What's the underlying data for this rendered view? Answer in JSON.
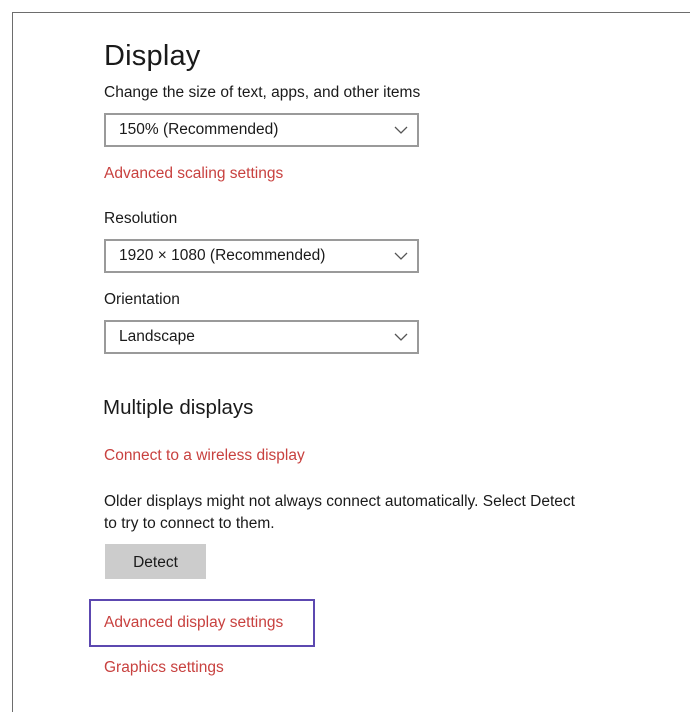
{
  "display": {
    "title": "Display",
    "scale_label": "Change the size of text, apps, and other items",
    "scale_value": "150% (Recommended)",
    "advanced_scaling_link": "Advanced scaling settings",
    "resolution_label": "Resolution",
    "resolution_value": "1920 × 1080 (Recommended)",
    "orientation_label": "Orientation",
    "orientation_value": "Landscape"
  },
  "multiple_displays": {
    "title": "Multiple displays",
    "wireless_link": "Connect to a wireless display",
    "description": "Older displays might not always connect automatically. Select Detect to try to connect to them.",
    "detect_button": "Detect",
    "advanced_display_link": "Advanced display settings",
    "graphics_link": "Graphics settings"
  },
  "icons": {
    "dropdown": "chevron-down-icon"
  },
  "colors": {
    "link": "#c8413f",
    "highlight": "#5c48b0",
    "button_bg": "#cccccc"
  }
}
